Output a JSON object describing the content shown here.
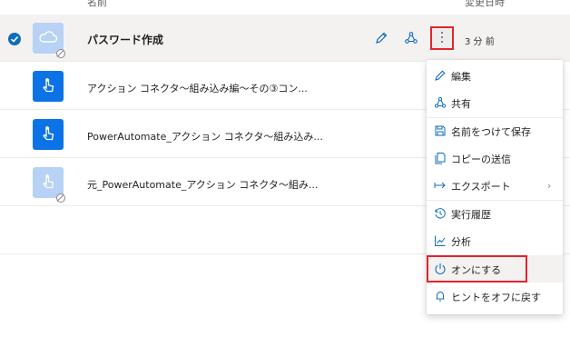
{
  "header": {
    "name_col": "名前",
    "modified_col": "変更日時"
  },
  "colors": {
    "accent": "#0f6cbd",
    "flow_icon": "#0b73e6",
    "flow_icon_off": "#b7d2f4",
    "highlight": "#e3242b"
  },
  "rows": [
    {
      "name": "パスワード作成",
      "modified": "3 分 前",
      "selected": true,
      "status": "off"
    },
    {
      "name": "アクション コネクタ～組み込み編～その③コン...",
      "selected": false,
      "status": "on"
    },
    {
      "name": "PowerAutomate_アクション コネクタ～組み込み...",
      "selected": false,
      "status": "on"
    },
    {
      "name": "元_PowerAutomate_アクション コネクタ～組み...",
      "selected": false,
      "status": "off"
    }
  ],
  "menu": {
    "items": [
      {
        "label": "編集",
        "icon": "pencil-icon"
      },
      {
        "label": "共有",
        "icon": "share-icon"
      },
      {
        "label": "名前をつけて保存",
        "icon": "save-as-icon"
      },
      {
        "label": "コピーの送信",
        "icon": "copy-icon"
      },
      {
        "label": "エクスポート",
        "icon": "export-icon",
        "submenu": true
      },
      {
        "label": "実行履歴",
        "icon": "history-icon"
      },
      {
        "label": "分析",
        "icon": "analytics-icon"
      },
      {
        "label": "オンにする",
        "icon": "power-icon"
      },
      {
        "label": "ヒントをオフに戻す",
        "icon": "bell-icon"
      }
    ]
  }
}
